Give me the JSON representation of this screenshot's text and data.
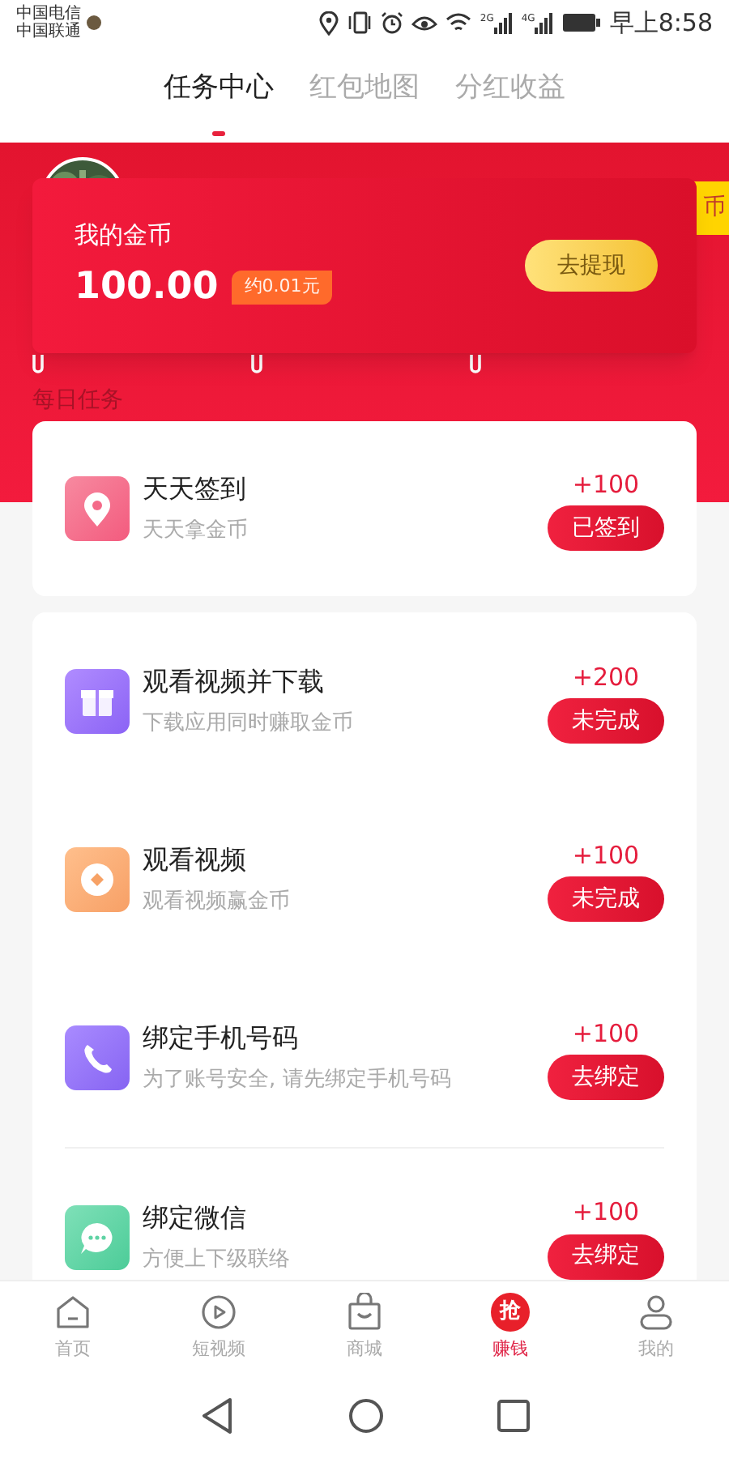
{
  "status_bar": {
    "carrier_1": "中国电信",
    "carrier_2": "中国联通",
    "network_1": "2G",
    "network_2": "4G",
    "time": "早上8:58"
  },
  "tabs": [
    {
      "label": "任务中心",
      "selected": true
    },
    {
      "label": "红包地图",
      "selected": false
    },
    {
      "label": "分红收益",
      "selected": false
    }
  ],
  "side_tag": "币",
  "coin_card": {
    "title": "我的金币",
    "amount": "100.00",
    "estimate": "约0.01元",
    "button": "去提现"
  },
  "section_title": "每日任务",
  "task_groups": [
    {
      "tasks": [
        {
          "title": "天天签到",
          "desc": "天天拿金币",
          "reward": "+100",
          "button": "已签到"
        }
      ]
    },
    {
      "tasks": [
        {
          "title": "观看视频并下载",
          "desc": "下载应用同时赚取金币",
          "reward": "+200",
          "button": "未完成"
        },
        {
          "title": "观看视频",
          "desc": "观看视频赢金币",
          "reward": "+100",
          "button": "未完成"
        },
        {
          "title": "绑定手机号码",
          "desc": "为了账号安全, 请先绑定手机号码",
          "reward": "+100",
          "button": "去绑定"
        },
        {
          "title": "绑定微信",
          "desc": "方便上下级联络",
          "reward": "+100",
          "button": "去绑定"
        }
      ]
    }
  ],
  "bottom_nav": [
    {
      "label": "首页",
      "selected": false
    },
    {
      "label": "短视频",
      "selected": false
    },
    {
      "label": "商城",
      "selected": false
    },
    {
      "icon_text": "抢",
      "label": "赚钱",
      "selected": true
    },
    {
      "label": "我的",
      "selected": false
    }
  ]
}
